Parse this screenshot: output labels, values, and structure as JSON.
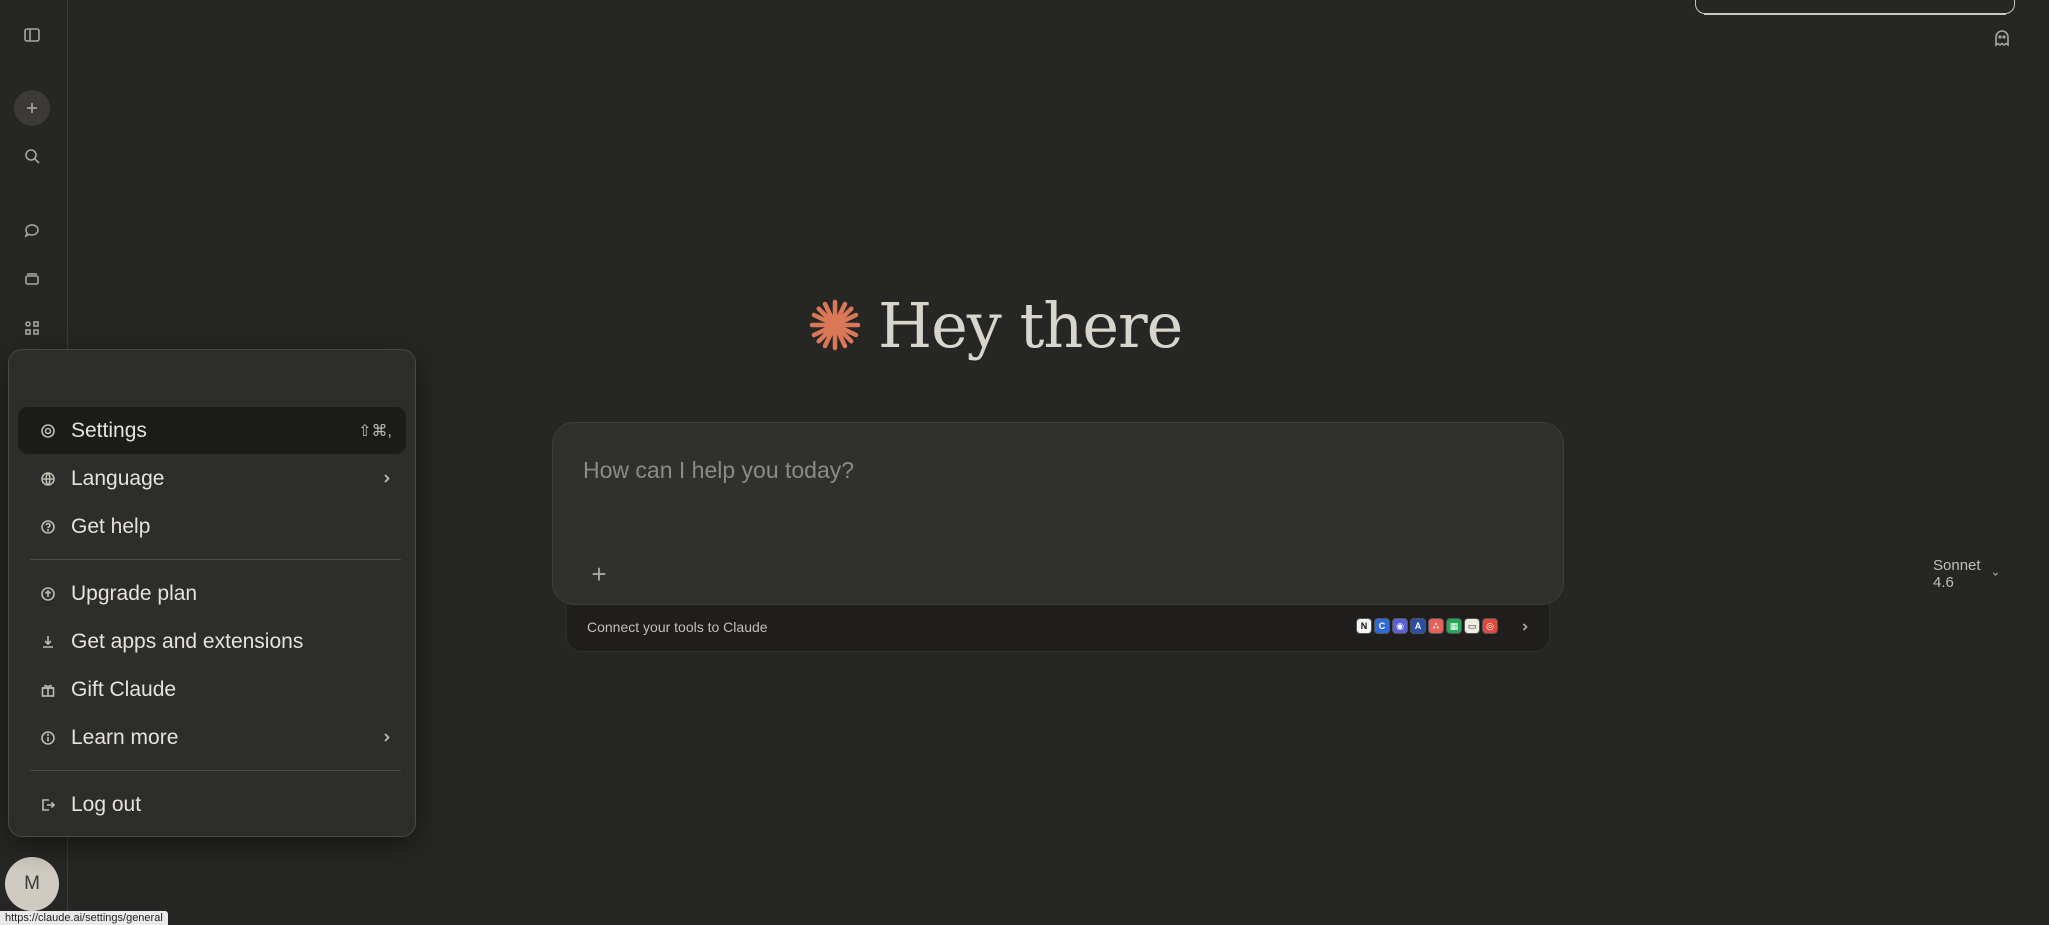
{
  "greeting": {
    "text": "Hey there"
  },
  "composer": {
    "placeholder": "How can I help you today?",
    "model": "Sonnet 4.6"
  },
  "connect_bar": {
    "text": "Connect your tools to Claude",
    "tool_icons": [
      "notion-icon",
      "c-icon",
      "globe-icon",
      "a-icon",
      "asana-icon",
      "sheets-icon",
      "note-icon",
      "chrome-icon"
    ]
  },
  "account_menu": {
    "items": [
      {
        "label": "Settings",
        "shortcut": "⇧⌘,",
        "icon": "gear-icon"
      },
      {
        "label": "Language",
        "icon": "globe-icon"
      },
      {
        "label": "Get help",
        "icon": "help-icon"
      },
      {
        "label": "Upgrade plan",
        "icon": "upgrade-icon"
      },
      {
        "label": "Get apps and extensions",
        "icon": "download-icon"
      },
      {
        "label": "Gift Claude",
        "icon": "gift-icon"
      },
      {
        "label": "Learn more",
        "icon": "info-icon"
      },
      {
        "label": "Log out",
        "icon": "logout-icon"
      }
    ]
  },
  "user": {
    "initial": "M"
  },
  "status_bar": {
    "url": "https://claude.ai/settings/general"
  },
  "colors": {
    "background": "#262624",
    "accent": "#d97757",
    "menu_background": "#2d2d2b",
    "composer_background": "#30302e"
  }
}
